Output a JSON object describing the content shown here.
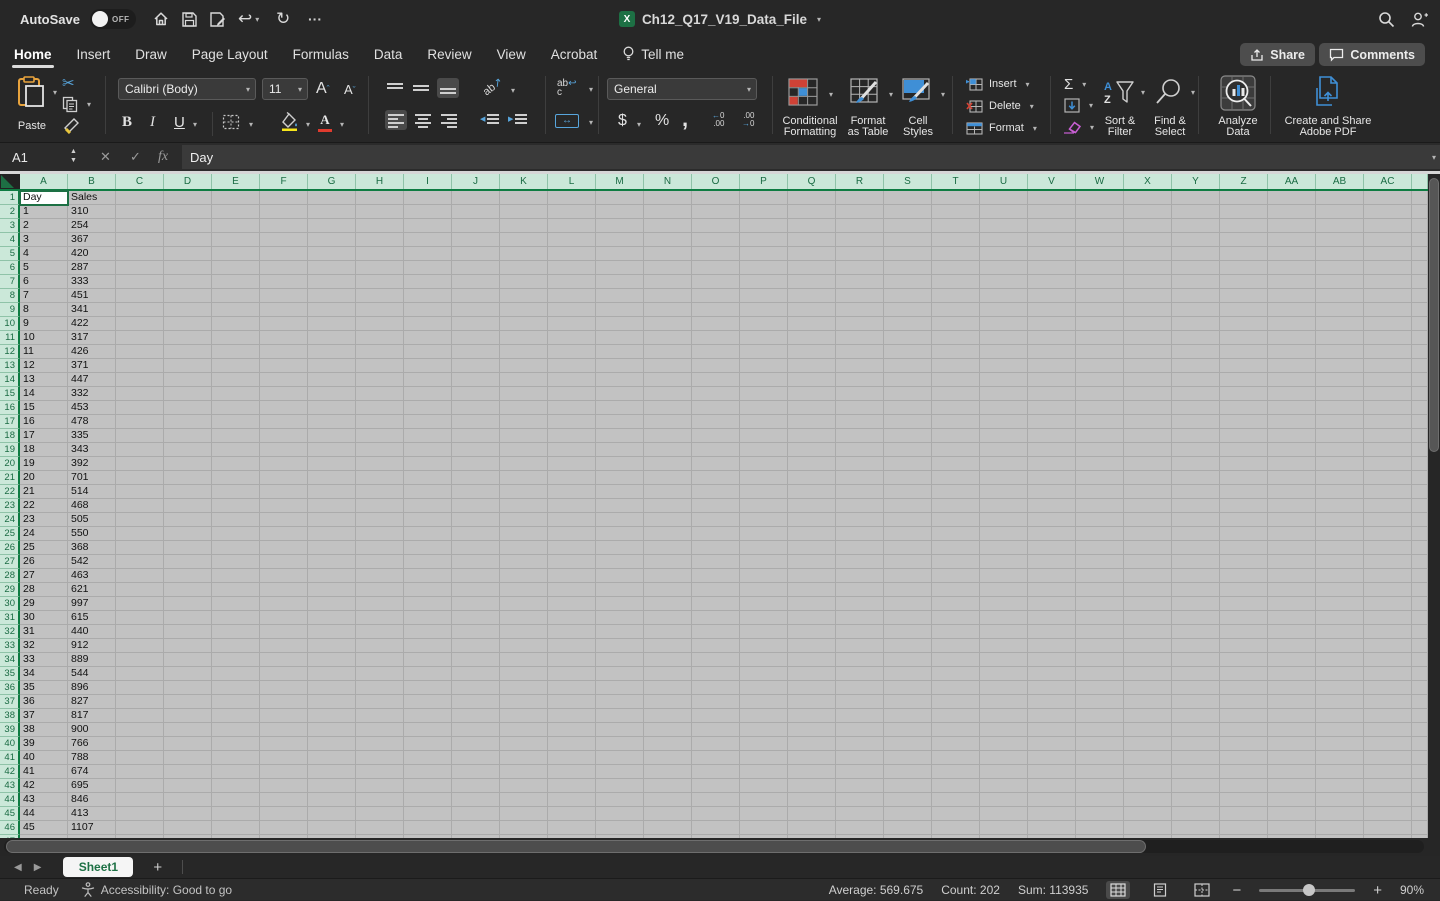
{
  "titlebar": {
    "autosave": "AutoSave",
    "autosave_state": "OFF",
    "title": "Ch12_Q17_V19_Data_File"
  },
  "tabs": {
    "active": "Home",
    "items": [
      "Home",
      "Insert",
      "Draw",
      "Page Layout",
      "Formulas",
      "Data",
      "Review",
      "View",
      "Acrobat",
      "Tell me"
    ]
  },
  "top_buttons": {
    "share": "Share",
    "comments": "Comments"
  },
  "ribbon": {
    "paste": "Paste",
    "font_name": "Calibri (Body)",
    "font_size": "11",
    "number_format": "General",
    "conditional_1": "Conditional",
    "conditional_2": "Formatting",
    "format_table_1": "Format",
    "format_table_2": "as Table",
    "cell_styles_1": "Cell",
    "cell_styles_2": "Styles",
    "insert": "Insert",
    "delete": "Delete",
    "format": "Format",
    "sort_1": "Sort &",
    "sort_2": "Filter",
    "find_1": "Find &",
    "find_2": "Select",
    "analyze_1": "Analyze",
    "analyze_2": "Data",
    "pdf_1": "Create and Share",
    "pdf_2": "Adobe PDF"
  },
  "formula_bar": {
    "cell_ref": "A1",
    "content": "Day"
  },
  "sheet": {
    "columns": [
      "A",
      "B",
      "C",
      "D",
      "E",
      "F",
      "G",
      "H",
      "I",
      "J",
      "K",
      "L",
      "M",
      "N",
      "O",
      "P",
      "Q",
      "R",
      "S",
      "T",
      "U",
      "V",
      "W",
      "X",
      "Y",
      "Z",
      "AA",
      "AB",
      "AC"
    ],
    "active_cell": "A1",
    "headers": [
      "Day",
      "Sales"
    ],
    "data": [
      [
        1,
        310
      ],
      [
        2,
        254
      ],
      [
        3,
        367
      ],
      [
        4,
        420
      ],
      [
        5,
        287
      ],
      [
        6,
        333
      ],
      [
        7,
        451
      ],
      [
        8,
        341
      ],
      [
        9,
        422
      ],
      [
        10,
        317
      ],
      [
        11,
        426
      ],
      [
        12,
        371
      ],
      [
        13,
        447
      ],
      [
        14,
        332
      ],
      [
        15,
        453
      ],
      [
        16,
        478
      ],
      [
        17,
        335
      ],
      [
        18,
        343
      ],
      [
        19,
        392
      ],
      [
        20,
        701
      ],
      [
        21,
        514
      ],
      [
        22,
        468
      ],
      [
        23,
        505
      ],
      [
        24,
        550
      ],
      [
        25,
        368
      ],
      [
        26,
        542
      ],
      [
        27,
        463
      ],
      [
        28,
        621
      ],
      [
        29,
        997
      ],
      [
        30,
        615
      ],
      [
        31,
        440
      ],
      [
        32,
        912
      ],
      [
        33,
        889
      ],
      [
        34,
        544
      ],
      [
        35,
        896
      ],
      [
        36,
        827
      ],
      [
        37,
        817
      ],
      [
        38,
        900
      ],
      [
        39,
        766
      ],
      [
        40,
        788
      ],
      [
        41,
        674
      ],
      [
        42,
        695
      ],
      [
        43,
        846
      ],
      [
        44,
        413
      ],
      [
        45,
        1107
      ]
    ]
  },
  "sheet_tabs": {
    "active": "Sheet1"
  },
  "status_bar": {
    "mode": "Ready",
    "accessibility": "Accessibility: Good to go",
    "average": "Average: 569.675",
    "count": "Count: 202",
    "sum": "Sum: 113935",
    "zoom": "90%"
  },
  "colors": {
    "excel_green": "#1d7044",
    "header_green": "#cbe8d9",
    "accent_blue": "#58a6dd",
    "fill_yellow": "#f7e61c",
    "font_red": "#e03b2e"
  }
}
